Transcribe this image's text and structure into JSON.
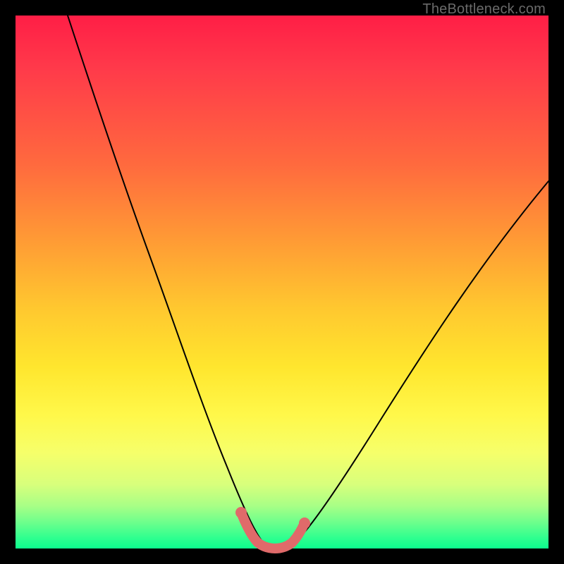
{
  "watermark": "TheBottleneck.com",
  "colors": {
    "background_frame": "#000000",
    "gradient_top": "#ff1e46",
    "gradient_mid_upper": "#ff9a35",
    "gradient_mid": "#fff84a",
    "gradient_bottom": "#0cfd8e",
    "curve_stroke": "#000000",
    "highlight_stroke": "#e06a6a"
  },
  "chart_data": {
    "type": "line",
    "title": "",
    "xlabel": "",
    "ylabel": "",
    "xlim": [
      0,
      100
    ],
    "ylim": [
      0,
      100
    ],
    "series": [
      {
        "name": "bottleneck_curve",
        "x": [
          10,
          15,
          20,
          25,
          30,
          35,
          38,
          40,
          42,
          44,
          46,
          48,
          50,
          55,
          60,
          65,
          70,
          75,
          80,
          85,
          90,
          95,
          100
        ],
        "y": [
          100,
          85,
          70,
          56,
          42,
          28,
          18,
          12,
          6,
          2,
          0,
          0,
          0,
          3,
          8,
          15,
          23,
          31,
          39,
          47,
          54,
          60,
          65
        ]
      },
      {
        "name": "optimal_range_highlight",
        "x": [
          42,
          44,
          46,
          48,
          50,
          52
        ],
        "y": [
          6,
          2,
          0,
          0,
          0,
          2
        ]
      }
    ],
    "annotations": []
  }
}
